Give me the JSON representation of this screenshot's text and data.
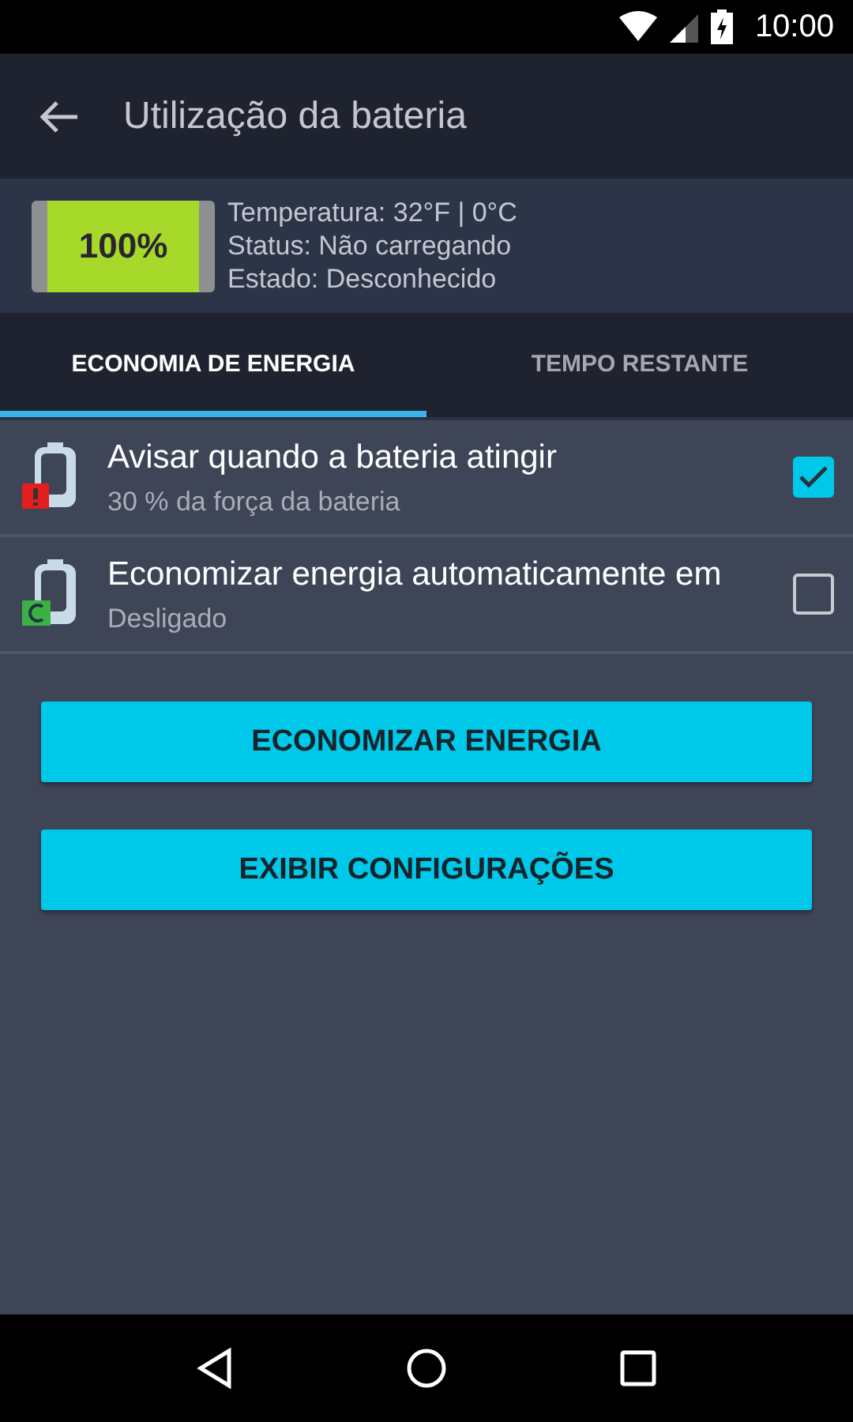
{
  "status_bar": {
    "time": "10:00"
  },
  "app_bar": {
    "title": "Utilização da bateria"
  },
  "battery": {
    "percent": "100%",
    "lines": [
      "Temperatura: 32°F | 0°C",
      "Status: Não carregando",
      "Estado: Desconhecido"
    ]
  },
  "tabs": [
    {
      "label": "ECONOMIA DE ENERGIA",
      "selected": true
    },
    {
      "label": "TEMPO RESTANTE",
      "selected": false
    }
  ],
  "settings": [
    {
      "kind": "warning",
      "title": "Avisar quando a bateria atingir",
      "subtitle": "30 % da força da bateria",
      "checked": true
    },
    {
      "kind": "auto",
      "title": "Economizar energia automaticamente em",
      "subtitle": "Desligado",
      "checked": false
    }
  ],
  "buttons": [
    "ECONOMIZAR ENERGIA",
    "EXIBIR CONFIGURAÇÕES"
  ]
}
